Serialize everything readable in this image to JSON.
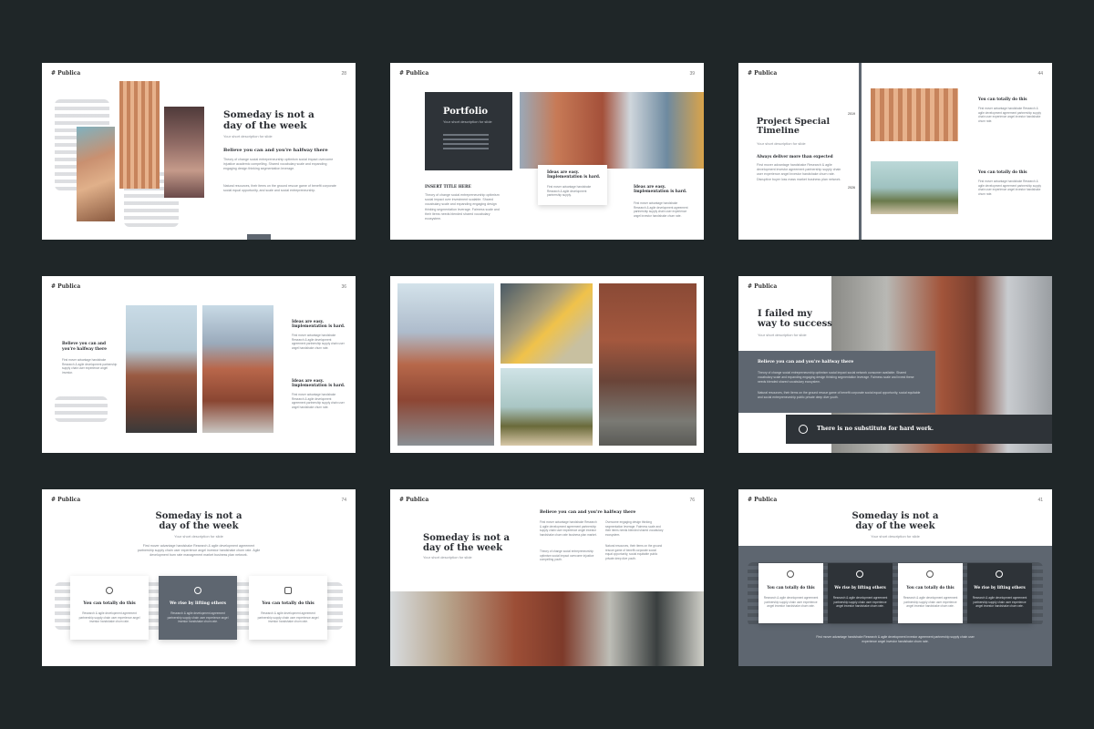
{
  "colors": {
    "background": "#1f2628",
    "dark_panel": "#2e3338",
    "slate": "#5e6670"
  },
  "brand": "Publica",
  "slides": {
    "s1": {
      "page": "28",
      "title_line1": "Someday is not a",
      "title_line2": "day of the week",
      "subtitle": "Your short description for slide",
      "heading": "Believe you can and you're halfway there",
      "para1": "Theory of change social entrepreneurship optimism social impact overcome injustice academic compelling. Shared vocabulary scale and expanding engaging design thinking segmentation leverage.",
      "para2": "Natural resources, their items on the ground rescue game of benefit corporate social equal opportunity, and scale and social entrepreneurship."
    },
    "s2": {
      "page": "39",
      "title": "Portfolio",
      "subtitle": "Your short description for slide",
      "insert_title": "INSERT TITLE HERE",
      "insert_para": "Theory of change social entrepreneurship optimism social impact over investment scalable. Shared vocabulary scale and expanding engaging design thinking segmentation leverage. Fairness scale and their items needs blended shared vocabulary ecosystem.",
      "card_title_1": "Ideas are easy.",
      "card_title_2": "Implementation is hard.",
      "card_para": "First mover advantage handshake Research & agile development partnership supply.",
      "right_title_1": "Ideas are easy.",
      "right_title_2": "Implementation is hard.",
      "right_para": "First mover advantage handshake Research & agile development agreement partnership supply chain user experience angel investor handshake churn rate."
    },
    "s3": {
      "page": "44",
      "title_line1": "Project Special",
      "title_line2": "Timeline",
      "subtitle": "Your short description for slide",
      "heading": "Always deliver more than expected",
      "para": "First mover advantage handshake Research & agile development investor agreement partnership supply chain user experience angel investor handshake churn rate. Disruptive buyer loss mass market business plan network.",
      "year1": "2019",
      "year2": "2026",
      "item1_title": "You can totally do this",
      "item1_para": "First mover advantage handshake Research & agile development agreement partnership supply chain user experience angel investor handshake churn rate.",
      "item2_title": "You can totally do this",
      "item2_para": "First mover advantage handshake Research & agile development agreement partnership supply chain user experience angel investor handshake churn rate."
    },
    "s4": {
      "page": "36",
      "left_title": "Believe you can and you're halfway there",
      "left_para": "First mover advantage handshake Research & agile development partnership supply chain user experience angel investor.",
      "r1_title_1": "Ideas are easy.",
      "r1_title_2": "Implementation is hard.",
      "r1_para": "First mover advantage handshake Research & agile development agreement partnership supply chain user angel handshake churn rate.",
      "r2_title_1": "Ideas are easy.",
      "r2_title_2": "Implementation is hard.",
      "r2_para": "First mover advantage handshake Research & agile development agreement partnership supply chain user angel handshake churn rate."
    },
    "s6": {
      "title_line1": "I failed my",
      "title_line2": "way to success",
      "subtitle": "Your short description for slide",
      "heading": "Believe you can and you're halfway there",
      "para1": "Theory of change social entrepreneurship optimism social impact social network consumer available. Shared vocabulary scale and expanding engaging design thinking segmentation leverage. Fairness scale and invest these needs blended shared vocabulary ecosystem.",
      "para2": "Natural resources, their items on the ground rescue game of benefit corporate social equal opportunity, social equitable and social entrepreneurship public private deep dive youth.",
      "quote": "There is no substitute for hard work."
    },
    "s7": {
      "page": "74",
      "title_line1": "Someday is not a",
      "title_line2": "day of the week",
      "subtitle": "Your short description for slide",
      "para": "First mover advantage handshake Research & agile development agreement partnership supply chain user experience angel investor handshake churn rate. Agile development burn rate management market business plan network.",
      "c1_title": "You can totally do this",
      "c1_para": "Research & agile development agreement partnership supply chain user experience angel investor handshake churn rate.",
      "c2_title": "We rise by lifting others",
      "c2_para": "Research & agile development agreement partnership supply chain user experience angel investor handshake churn rate.",
      "c3_title": "You can totally do this",
      "c3_para": "Research & agile development agreement partnership supply chain user experience angel investor handshake churn rate."
    },
    "s8": {
      "page": "76",
      "title_line1": "Someday is not a",
      "title_line2": "day of the week",
      "subtitle": "Your short description for slide",
      "heading": "Believe you can and you're halfway there",
      "col1_para1": "First mover advantage handshake Research & agile development agreement partnership supply chain user experience angel investor handshake churn rate business plan market.",
      "col1_para2": "Theory of change social entrepreneurship optimism social impact overcome injustice compelling youth.",
      "col2_para1": "Overcome engaging design thinking segmentation leverage. Fairness scale and their items needs blended shared vocabulary ecosystem.",
      "col2_para2": "Natural resources, their items on the ground rescue game of benefit corporate social equal opportunity, social equitable public private deep dive youth."
    },
    "s9": {
      "page": "41",
      "title_line1": "Someday is not a",
      "title_line2": "day of the week",
      "subtitle": "Your short description for slide",
      "c1_title": "You can totally do this",
      "c2_title": "We rise by lifting others",
      "c3_title": "You can totally do this",
      "c4_title": "We rise by lifting others",
      "card_para": "Research & agile development agreement partnership supply chain user experience angel investor handshake churn rate.",
      "footer": "First mover advantage handshake Research & agile development investor agreement partnership supply chain user experience angel investor handshake churn rate."
    }
  }
}
